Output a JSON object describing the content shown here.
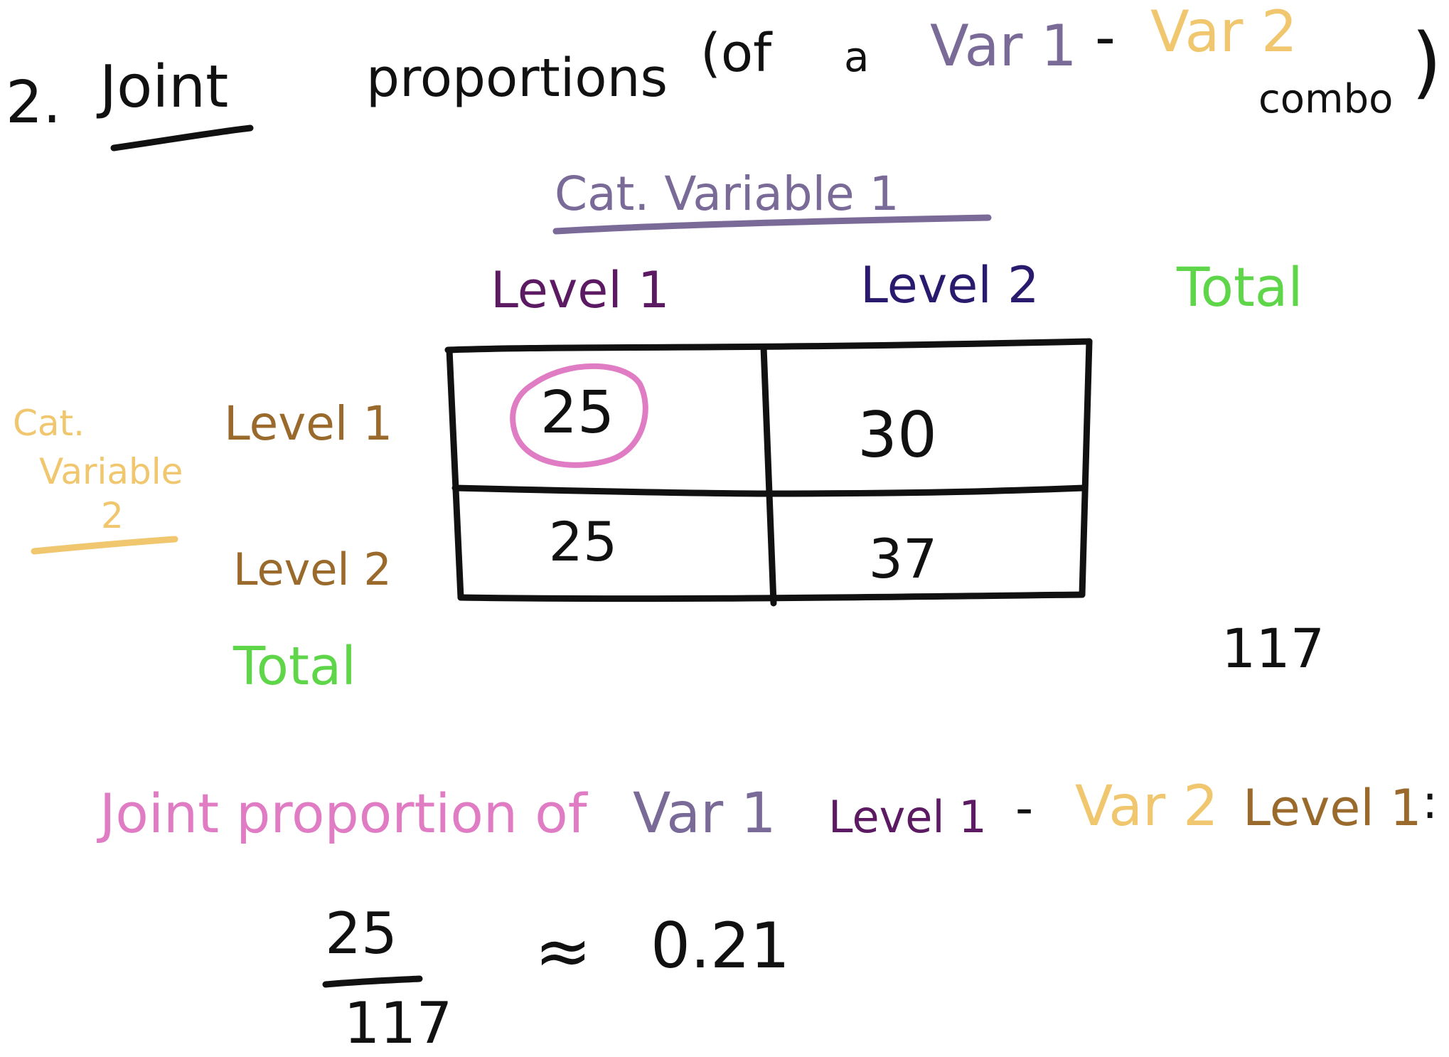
{
  "heading": {
    "number": "2.",
    "word1": "Joint",
    "word2": "proportions",
    "open_paren": "(of",
    "article": "a",
    "var1": "Var 1",
    "dash": "-",
    "var2": "Var 2",
    "combo": "combo",
    "close_paren": ")"
  },
  "table": {
    "col_variable_title": "Cat. Variable 1",
    "col_level_1": "Level 1",
    "col_level_2": "Level 2",
    "col_total": "Total",
    "row_variable_title_line1": "Cat.",
    "row_variable_title_line2": "Variable",
    "row_variable_title_line3": "2",
    "row_level_1": "Level 1",
    "row_level_2": "Level 2",
    "row_total": "Total",
    "cells": [
      [
        "25",
        "30"
      ],
      [
        "25",
        "37"
      ]
    ],
    "grand_total": "117",
    "highlighted_cell": "25"
  },
  "statement": {
    "prefix": "Joint proportion of",
    "var1": "Var 1",
    "var1_level": "Level 1",
    "dash": "-",
    "var2": "Var 2",
    "var2_level": "Level 1",
    "colon": ":"
  },
  "calculation": {
    "numerator": "25",
    "denominator": "117",
    "approx": "≈",
    "result": "0.21"
  },
  "colors": {
    "ink": "#111111",
    "var1_purple": "#7a6a98",
    "var1_level1": "#5c1a63",
    "var1_level2": "#2a1a6e",
    "var2_gold": "#f0c66e",
    "var2_brown": "#9a6a2c",
    "total_green": "#5fd64a",
    "pink": "#e07cc4"
  }
}
